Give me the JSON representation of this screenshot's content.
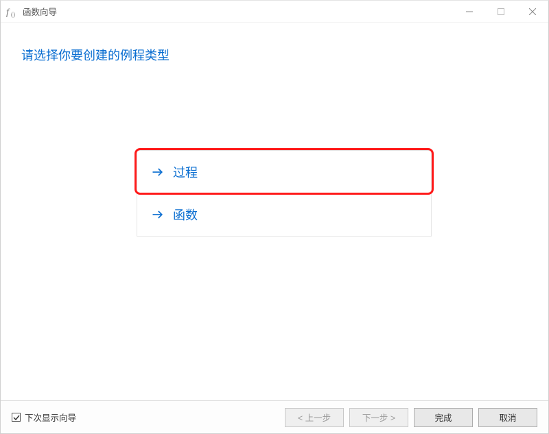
{
  "window": {
    "title": "函数向导"
  },
  "page": {
    "heading": "请选择你要创建的例程类型"
  },
  "options": {
    "items": [
      {
        "label": "过程"
      },
      {
        "label": "函数"
      }
    ]
  },
  "footer": {
    "show_next_time_label": "下次显示向导",
    "show_next_time_checked": true,
    "buttons": {
      "back": "< 上一步",
      "next": "下一步 >",
      "finish": "完成",
      "cancel": "取消"
    }
  }
}
